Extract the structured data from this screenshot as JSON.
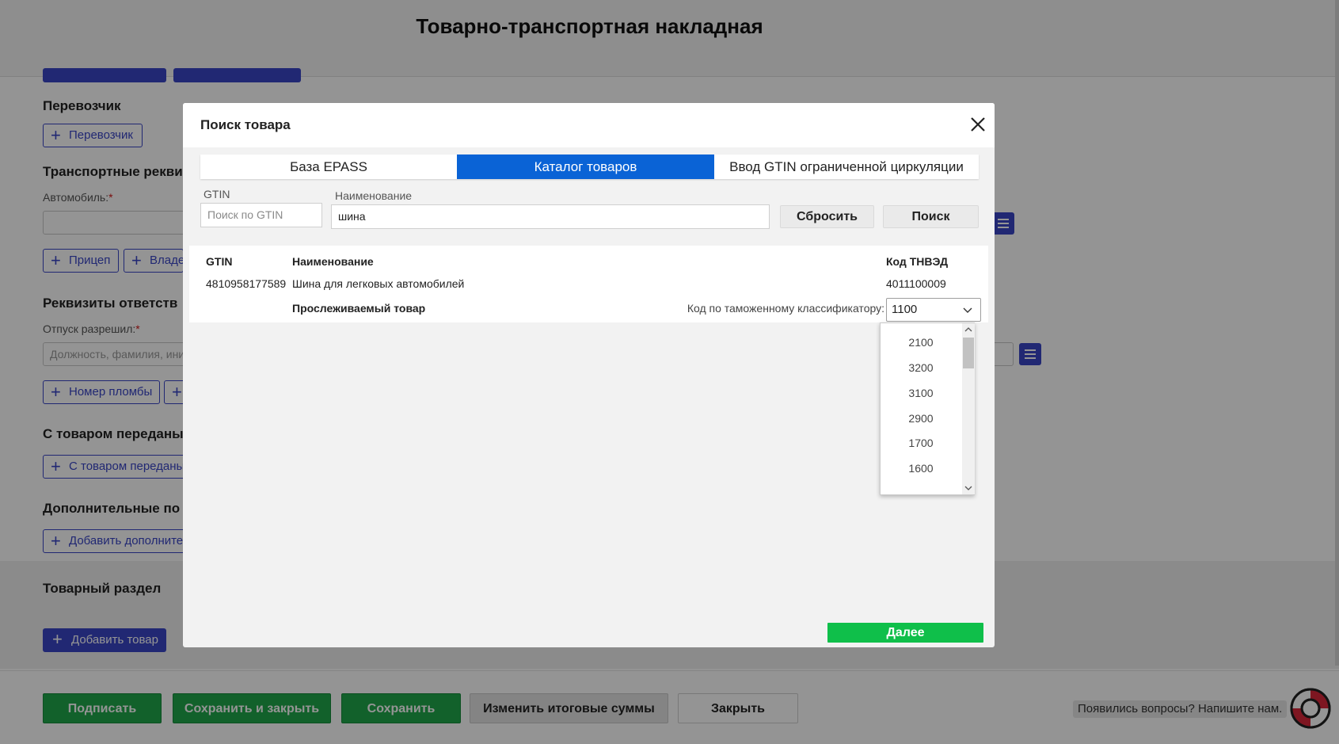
{
  "page": {
    "title": "Товарно-транспортная накладная",
    "sections": {
      "carrier": {
        "title": "Перевозчик",
        "add_label": "Перевозчик"
      },
      "transport": {
        "title": "Транспортные рекви",
        "car_label": "Автомобиль:",
        "required_mark": "*",
        "trailer_label": "Прицеп",
        "owner_label": "Владе"
      },
      "responsible": {
        "title": "Реквизиты ответств",
        "released_label": "Отпуск разрешил:",
        "required_mark": "*",
        "released_placeholder": "Должность, фамилия, ини",
        "seal_label": "Номер пломбы"
      },
      "transferred": {
        "title": "С товаром переданы",
        "add_label": "С товаром переданы"
      },
      "extra": {
        "title": "Дополнительные по",
        "add_label": "Добавить дополните"
      },
      "goods": {
        "title": "Товарный раздел",
        "add_label": "Добавить товар"
      }
    },
    "footer": {
      "sign": "Подписать",
      "save_close": "Сохранить и закрыть",
      "save": "Сохранить",
      "change_totals": "Изменить итоговые суммы",
      "close": "Закрыть",
      "help_text": "Появились вопросы? Напишите нам."
    }
  },
  "modal": {
    "title": "Поиск товара",
    "tabs": [
      {
        "label": "База EPASS",
        "active": false
      },
      {
        "label": "Каталог товаров",
        "active": true
      },
      {
        "label": "Ввод GTIN ограниченной циркуляции",
        "active": false
      }
    ],
    "filters": {
      "gtin_label": "GTIN",
      "gtin_placeholder": "Поиск по GTIN",
      "name_label": "Наименование",
      "name_value": "шина",
      "reset": "Сбросить",
      "search": "Поиск"
    },
    "results": {
      "headers": {
        "gtin": "GTIN",
        "name": "Наименование",
        "tnved": "Код ТНВЭД"
      },
      "row": {
        "gtin": "4810958177589",
        "name": "Шина для легковых автомобилей",
        "tnved": "4011100009",
        "tracked": "Прослеживаемый товар",
        "customs_label": "Код по таможенному классификатору:",
        "customs_value": "1100"
      }
    },
    "dropdown_options": [
      "2100",
      "3200",
      "3100",
      "2900",
      "1700",
      "1600"
    ],
    "next": "Далее"
  },
  "colors": {
    "accent_blue": "#3a46c7",
    "tab_active": "#0a63d6",
    "green": "#1fa84a",
    "next_green": "#0fbf4a"
  }
}
